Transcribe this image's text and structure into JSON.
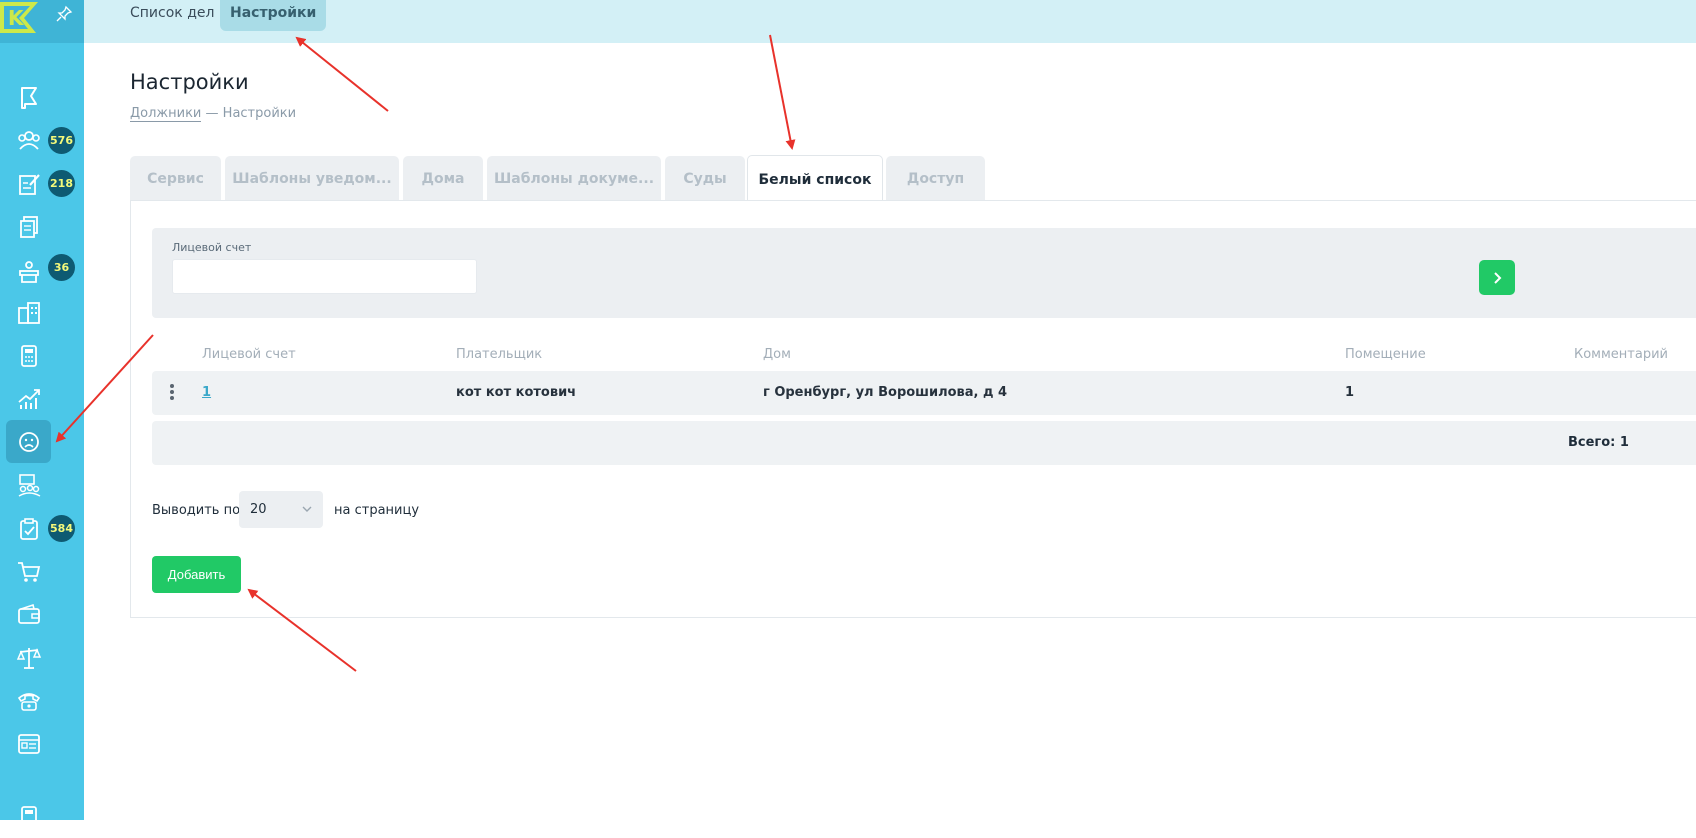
{
  "topbar": {
    "tabs": [
      {
        "label": "Список дел"
      },
      {
        "label": "Настройки"
      }
    ]
  },
  "sidebar": {
    "logo": "K",
    "badges": {
      "debtors": "576",
      "cases": "218",
      "court": "36",
      "tasks": "584"
    },
    "items": [
      {
        "icon": "flag-icon"
      },
      {
        "icon": "users-group-icon"
      },
      {
        "icon": "edit-document-icon"
      },
      {
        "icon": "documents-icon"
      },
      {
        "icon": "court-icon"
      },
      {
        "icon": "buildings-icon"
      },
      {
        "icon": "calculator-icon"
      },
      {
        "icon": "chart-growth-icon"
      },
      {
        "icon": "sad-face-icon"
      },
      {
        "icon": "team-icon"
      },
      {
        "icon": "clipboard-check-icon"
      },
      {
        "icon": "cart-icon"
      },
      {
        "icon": "wallet-icon"
      },
      {
        "icon": "scales-icon"
      },
      {
        "icon": "phone-icon"
      },
      {
        "icon": "card-window-icon"
      },
      {
        "icon": "device-icon"
      }
    ]
  },
  "page": {
    "title": "Настройки",
    "breadcrumb": {
      "link": "Должники",
      "separator": "—",
      "current": "Настройки"
    }
  },
  "tabs": [
    {
      "label": "Сервис"
    },
    {
      "label": "Шаблоны уведом..."
    },
    {
      "label": "Дома"
    },
    {
      "label": "Шаблоны докуме..."
    },
    {
      "label": "Суды"
    },
    {
      "label": "Белый список"
    },
    {
      "label": "Доступ"
    }
  ],
  "filter": {
    "label": "Лицевой счет",
    "value": "",
    "placeholder": ""
  },
  "table": {
    "columns": [
      "Лицевой счет",
      "Плательщик",
      "Дом",
      "Помещение",
      "Комментарий"
    ],
    "rows": [
      {
        "account": "1",
        "payer": "кот кот котович",
        "house": "г Оренбург, ул Ворошилова, д 4",
        "room": "1",
        "comment": ""
      }
    ],
    "total": "Всего: 1"
  },
  "pagination": {
    "label": "Выводить по",
    "value": "20",
    "suffix": "на страницу"
  },
  "actions": {
    "add_label": "Добавить"
  },
  "colors": {
    "sidebar": "#4bc7e8",
    "topbar": "#d3f0f6",
    "accent_green": "#21c966",
    "arrow": "#e8322b",
    "badge": "#0e5a72"
  }
}
